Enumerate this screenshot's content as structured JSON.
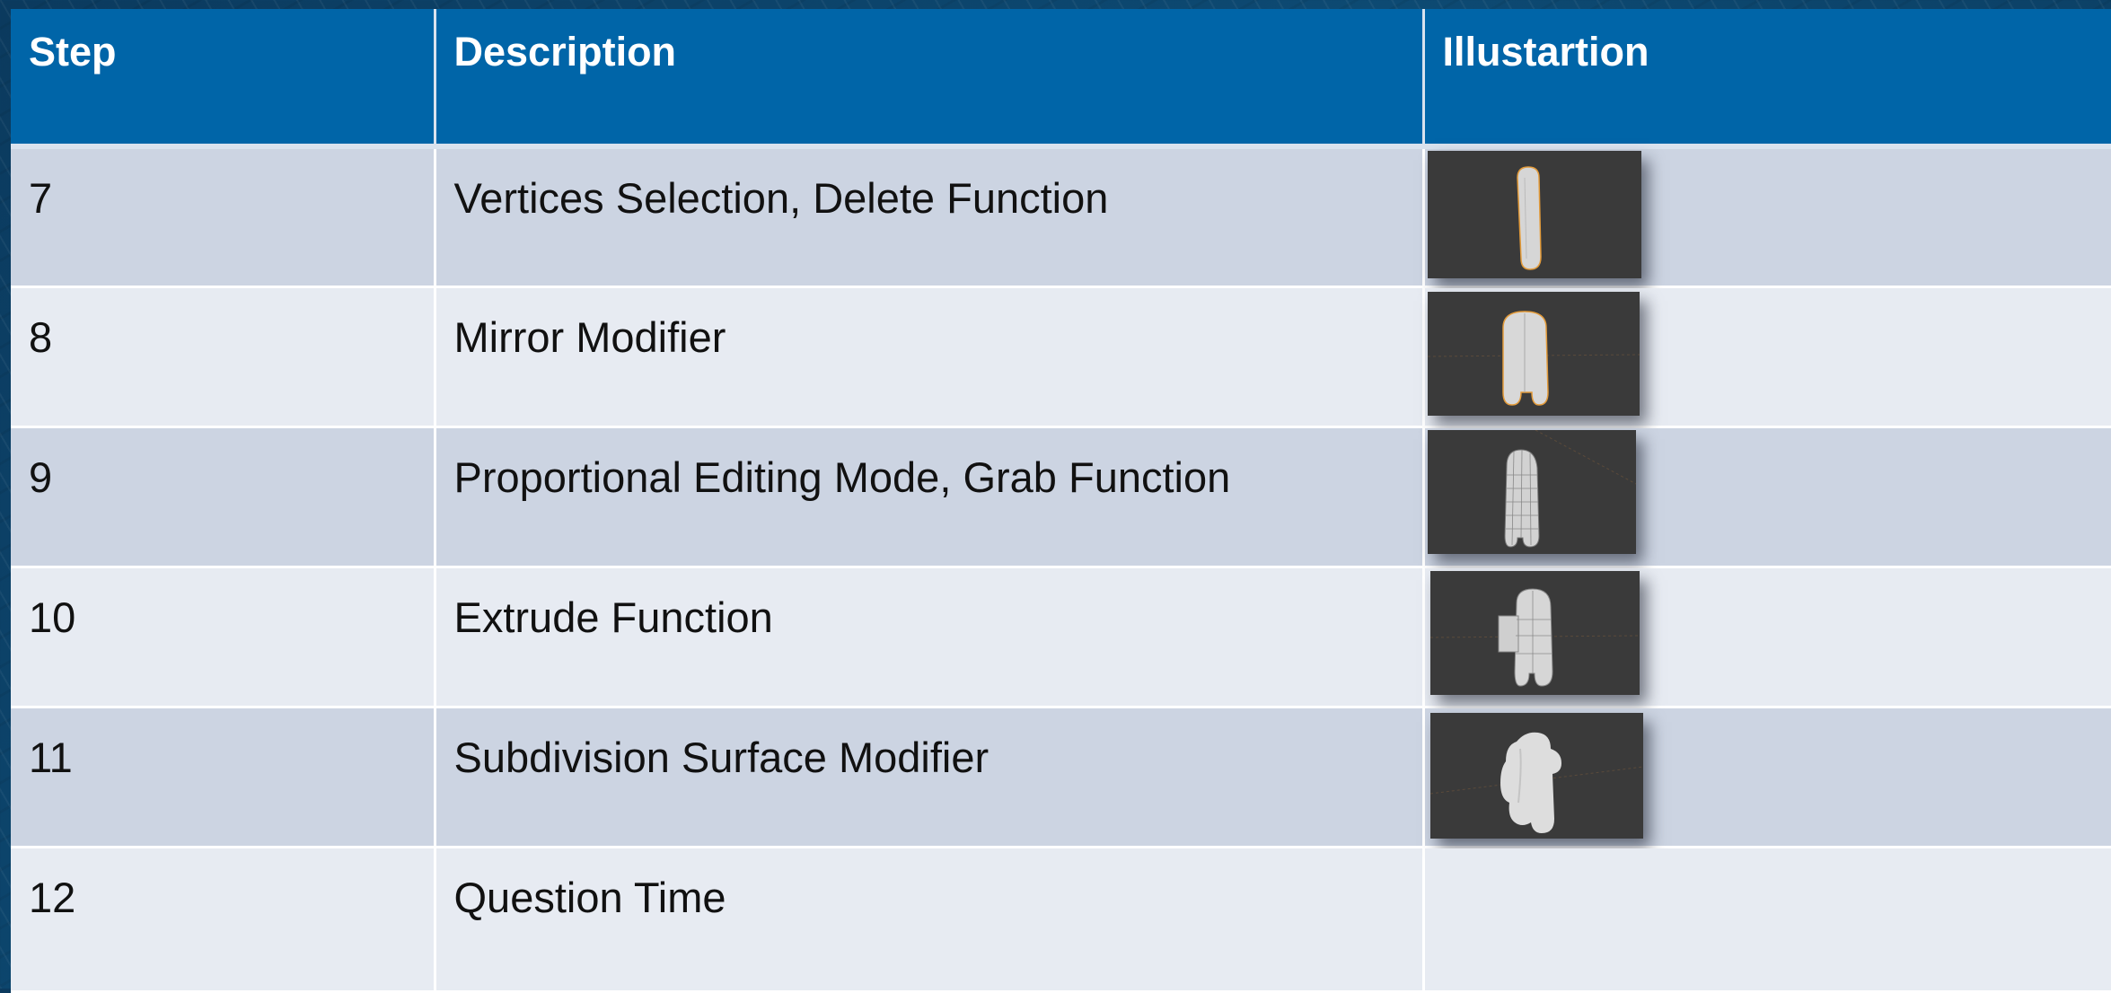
{
  "table": {
    "headers": {
      "step": "Step",
      "description": "Description",
      "illustration": "Illustartion"
    },
    "rows": [
      {
        "step": "7",
        "description": "Vertices Selection, Delete Function",
        "illustration_icon": "blender-model-thumbnail-icon"
      },
      {
        "step": "8",
        "description": "Mirror Modifier",
        "illustration_icon": "blender-model-thumbnail-icon"
      },
      {
        "step": "9",
        "description": "Proportional Editing Mode, Grab Function",
        "illustration_icon": "blender-model-thumbnail-icon"
      },
      {
        "step": "10",
        "description": "Extrude Function",
        "illustration_icon": "blender-model-thumbnail-icon"
      },
      {
        "step": "11",
        "description": "Subdivision Surface Modifier",
        "illustration_icon": "blender-model-thumbnail-icon"
      },
      {
        "step": "12",
        "description": "Question Time"
      }
    ]
  },
  "colors": {
    "header_bg": "#0065a8",
    "row_dark": "#ccd4e2",
    "row_light": "#e7ebf2",
    "thumbnail_bg": "#3b3b3b"
  }
}
